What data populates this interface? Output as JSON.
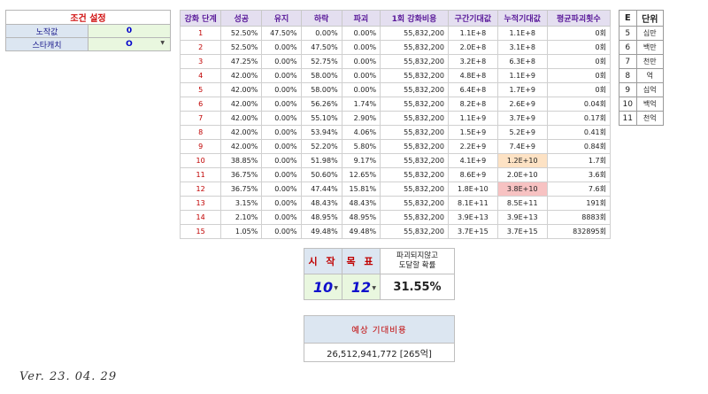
{
  "settings": {
    "title": "조건 설정",
    "rows": [
      {
        "label": "노작값",
        "value": "0",
        "dropdown": false
      },
      {
        "label": "스타캐치",
        "value": "O",
        "dropdown": true
      }
    ]
  },
  "main_table": {
    "headers": [
      "강화 단계",
      "성공",
      "유지",
      "하락",
      "파괴",
      "1회 강화비용",
      "구간기대값",
      "누적기대값",
      "평균파괴횟수"
    ],
    "rows": [
      [
        "1",
        "52.50%",
        "47.50%",
        "0.00%",
        "0.00%",
        "55,832,200",
        "1.1E+8",
        "1.1E+8",
        "0회"
      ],
      [
        "2",
        "52.50%",
        "0.00%",
        "47.50%",
        "0.00%",
        "55,832,200",
        "2.0E+8",
        "3.1E+8",
        "0회"
      ],
      [
        "3",
        "47.25%",
        "0.00%",
        "52.75%",
        "0.00%",
        "55,832,200",
        "3.2E+8",
        "6.3E+8",
        "0회"
      ],
      [
        "4",
        "42.00%",
        "0.00%",
        "58.00%",
        "0.00%",
        "55,832,200",
        "4.8E+8",
        "1.1E+9",
        "0회"
      ],
      [
        "5",
        "42.00%",
        "0.00%",
        "58.00%",
        "0.00%",
        "55,832,200",
        "6.4E+8",
        "1.7E+9",
        "0회"
      ],
      [
        "6",
        "42.00%",
        "0.00%",
        "56.26%",
        "1.74%",
        "55,832,200",
        "8.2E+8",
        "2.6E+9",
        "0.04회"
      ],
      [
        "7",
        "42.00%",
        "0.00%",
        "55.10%",
        "2.90%",
        "55,832,200",
        "1.1E+9",
        "3.7E+9",
        "0.17회"
      ],
      [
        "8",
        "42.00%",
        "0.00%",
        "53.94%",
        "4.06%",
        "55,832,200",
        "1.5E+9",
        "5.2E+9",
        "0.41회"
      ],
      [
        "9",
        "42.00%",
        "0.00%",
        "52.20%",
        "5.80%",
        "55,832,200",
        "2.2E+9",
        "7.4E+9",
        "0.84회"
      ],
      [
        "10",
        "38.85%",
        "0.00%",
        "51.98%",
        "9.17%",
        "55,832,200",
        "4.1E+9",
        "1.2E+10",
        "1.7회"
      ],
      [
        "11",
        "36.75%",
        "0.00%",
        "50.60%",
        "12.65%",
        "55,832,200",
        "8.6E+9",
        "2.0E+10",
        "3.6회"
      ],
      [
        "12",
        "36.75%",
        "0.00%",
        "47.44%",
        "15.81%",
        "55,832,200",
        "1.8E+10",
        "3.8E+10",
        "7.6회"
      ],
      [
        "13",
        "3.15%",
        "0.00%",
        "48.43%",
        "48.43%",
        "55,832,200",
        "8.1E+11",
        "8.5E+11",
        "191회"
      ],
      [
        "14",
        "2.10%",
        "0.00%",
        "48.95%",
        "48.95%",
        "55,832,200",
        "3.9E+13",
        "3.9E+13",
        "8883회"
      ],
      [
        "15",
        "1.05%",
        "0.00%",
        "49.48%",
        "49.48%",
        "55,832,200",
        "3.7E+15",
        "3.7E+15",
        "832895회"
      ]
    ],
    "highlight_colors": {
      "row10_cumulative": "#fde2c4",
      "row12_cumulative": "#f7c2c2"
    }
  },
  "unit_table": {
    "headers": [
      "E",
      "단위"
    ],
    "rows": [
      [
        "5",
        "십만"
      ],
      [
        "6",
        "백만"
      ],
      [
        "7",
        "천만"
      ],
      [
        "8",
        "억"
      ],
      [
        "9",
        "십억"
      ],
      [
        "10",
        "백억"
      ],
      [
        "11",
        "천억"
      ]
    ]
  },
  "calculator": {
    "start_label": "시 작",
    "goal_label": "목 표",
    "prob_label_line1": "파괴되지않고",
    "prob_label_line2": "도달할 확률",
    "start_value": "10",
    "goal_value": "12",
    "probability": "31.55%"
  },
  "expected_cost": {
    "label": "예상 기대비용",
    "value": "26,512,941,772  [265억]"
  },
  "version": "Ver. 23. 04. 29"
}
